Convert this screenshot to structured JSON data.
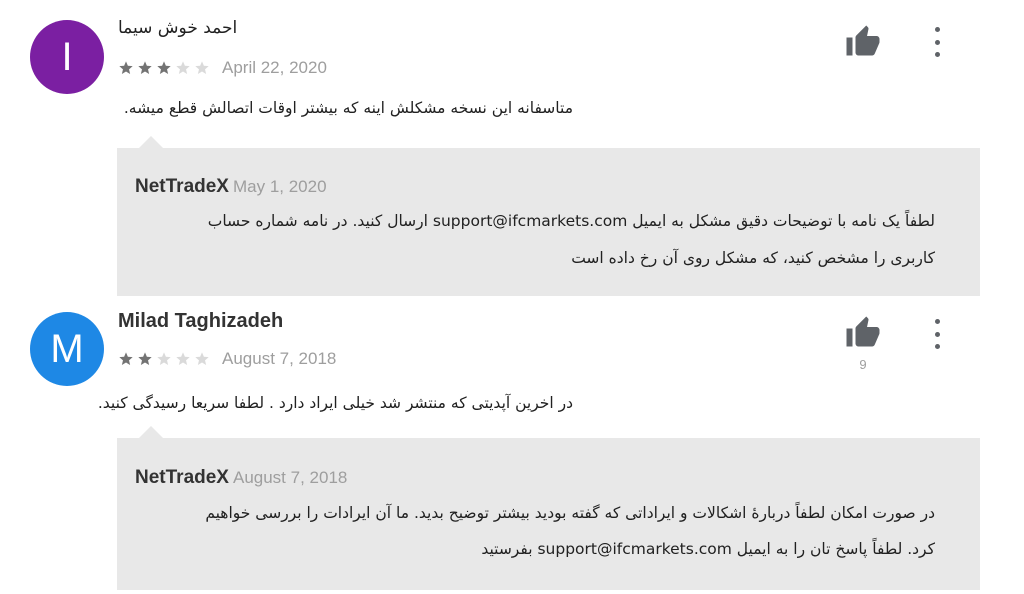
{
  "colors": {
    "avatar_1": "#7b1fa2",
    "avatar_2": "#1e88e5",
    "star_filled": "#737373",
    "star_empty": "#dadada",
    "reply_bg": "#e8e8e8"
  },
  "reviews": [
    {
      "avatar_letter": "I",
      "author": "احمد خوش سیما",
      "rating": 3,
      "date": "April 22, 2020",
      "text": "متاسفانه این نسخه مشکلش اینه که بیشتر اوقات اتصالش قطع میشه.",
      "helpful_count": "",
      "reply": {
        "developer": "NetTradeX",
        "date": "May 1, 2020",
        "lines": [
          "لطفاً یک نامه با توضیحات دقیق مشکل به ایمیل support@ifcmarkets.com ارسال کنید. در نامه شماره حساب",
          "کاربری را مشخص کنید، که مشکل روی آن رخ داده است"
        ]
      }
    },
    {
      "avatar_letter": "M",
      "author": "Milad Taghizadeh",
      "rating": 2,
      "date": "August 7, 2018",
      "text": "در اخرین آپدیتی که منتشر شد خیلی ایراد دارد . لطفا سریعا رسیدگی کنید.",
      "helpful_count": "9",
      "reply": {
        "developer": "NetTradeX",
        "date": "August 7, 2018",
        "lines": [
          "در صورت امکان لطفاً دربارهٔ اشکالات و ایراداتی که گفته بودید بیشتر توضیح بدید. ما آن ایرادات را بررسی خواهیم",
          "کرد. لطفاً پاسخ تان را به ایمیل support@ifcmarkets.com بفرستید"
        ]
      }
    }
  ],
  "icons": {
    "thumbs_up": "thumbs-up-icon",
    "more": "more-vert-icon",
    "star": "star-icon"
  }
}
